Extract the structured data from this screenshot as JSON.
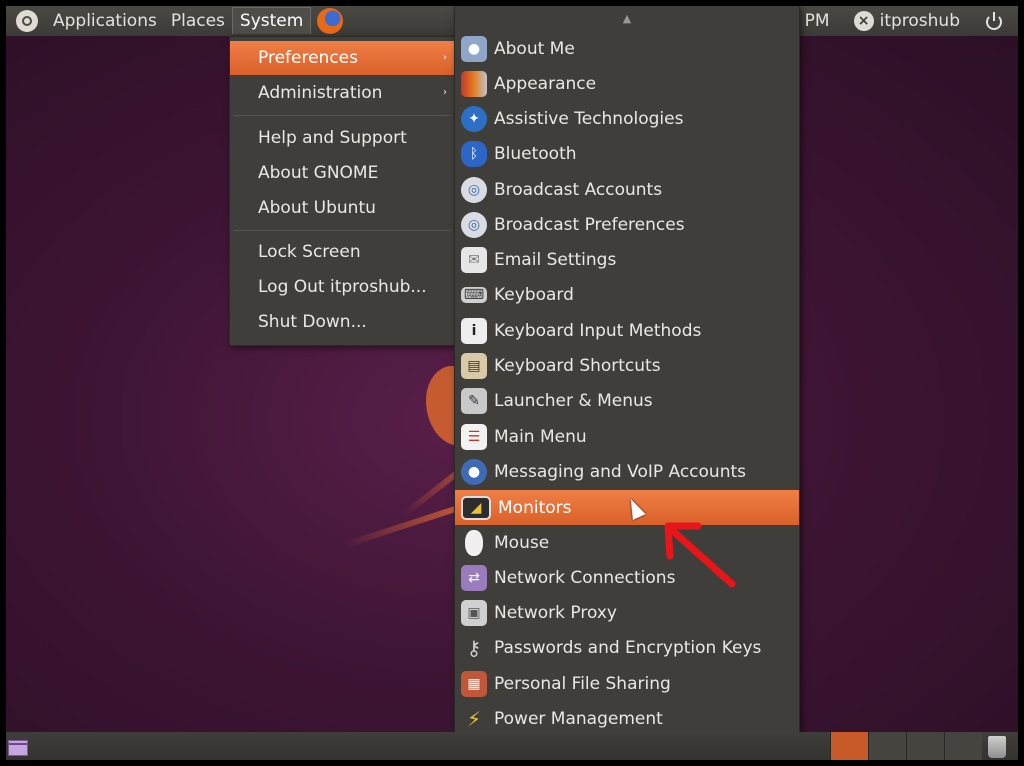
{
  "top_panel": {
    "applications": "Applications",
    "places": "Places",
    "system": "System",
    "time": "PM",
    "user": "itproshub"
  },
  "system_menu": {
    "items": [
      {
        "label": "Preferences",
        "submenu": true
      },
      {
        "label": "Administration",
        "submenu": true
      },
      {
        "label": "Help and Support"
      },
      {
        "label": "About GNOME"
      },
      {
        "label": "About Ubuntu"
      },
      {
        "label": "Lock Screen"
      },
      {
        "label": "Log Out itproshub..."
      },
      {
        "label": "Shut Down..."
      }
    ],
    "submenu_arrow": "›"
  },
  "preferences_menu": {
    "scroll_up": "▲",
    "scroll_down": "▼",
    "items": [
      {
        "label": "About Me",
        "icon": "user-card-icon"
      },
      {
        "label": "Appearance",
        "icon": "appearance-icon"
      },
      {
        "label": "Assistive Technologies",
        "icon": "accessibility-icon"
      },
      {
        "label": "Bluetooth",
        "icon": "bluetooth-icon"
      },
      {
        "label": "Broadcast Accounts",
        "icon": "broadcast-icon"
      },
      {
        "label": "Broadcast Preferences",
        "icon": "broadcast-icon"
      },
      {
        "label": "Email Settings",
        "icon": "email-icon"
      },
      {
        "label": "Keyboard",
        "icon": "keyboard-icon"
      },
      {
        "label": "Keyboard Input Methods",
        "icon": "info-icon"
      },
      {
        "label": "Keyboard Shortcuts",
        "icon": "shortcuts-icon"
      },
      {
        "label": "Launcher & Menus",
        "icon": "launcher-icon"
      },
      {
        "label": "Main Menu",
        "icon": "main-menu-icon"
      },
      {
        "label": "Messaging and VoIP Accounts",
        "icon": "messaging-icon"
      },
      {
        "label": "Monitors",
        "icon": "monitor-icon",
        "highlighted": true
      },
      {
        "label": "Mouse",
        "icon": "mouse-icon"
      },
      {
        "label": "Network Connections",
        "icon": "network-icon"
      },
      {
        "label": "Network Proxy",
        "icon": "proxy-icon"
      },
      {
        "label": "Passwords and Encryption Keys",
        "icon": "keys-icon"
      },
      {
        "label": "Personal File Sharing",
        "icon": "file-sharing-icon"
      },
      {
        "label": "Power Management",
        "icon": "power-management-icon"
      }
    ]
  },
  "colors": {
    "highlight": "#e8703a",
    "menu_bg": "#3f3e3a",
    "annotation_arrow": "#e8161a"
  }
}
